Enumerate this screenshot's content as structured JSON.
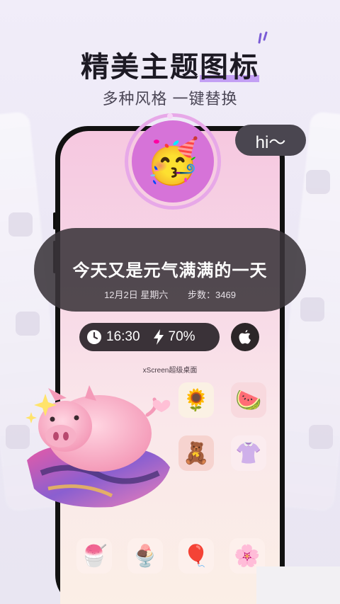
{
  "header": {
    "title_part1": "精美主题",
    "title_part2": "图标",
    "subtitle": "多种风格 一键替换"
  },
  "widget": {
    "bubble_text": "hi～",
    "emoji": "🥳",
    "banner_title": "今天又是元气满满的一天",
    "date": "12月2日 星期六",
    "steps": "步数：3469",
    "time": "16:30",
    "battery": "70%",
    "desktop_label": "xScreen超级桌面"
  },
  "apps": {
    "row1": [
      "🌻",
      "🍉"
    ],
    "row2": [
      "🧸",
      "👚"
    ],
    "dock": [
      "🍧",
      "🍨",
      "🎈",
      "🌸"
    ]
  },
  "colors": {
    "accent_purple": "#b88cf2",
    "ring_pink": "#d673d8",
    "banner_bg": "#3a343a"
  }
}
